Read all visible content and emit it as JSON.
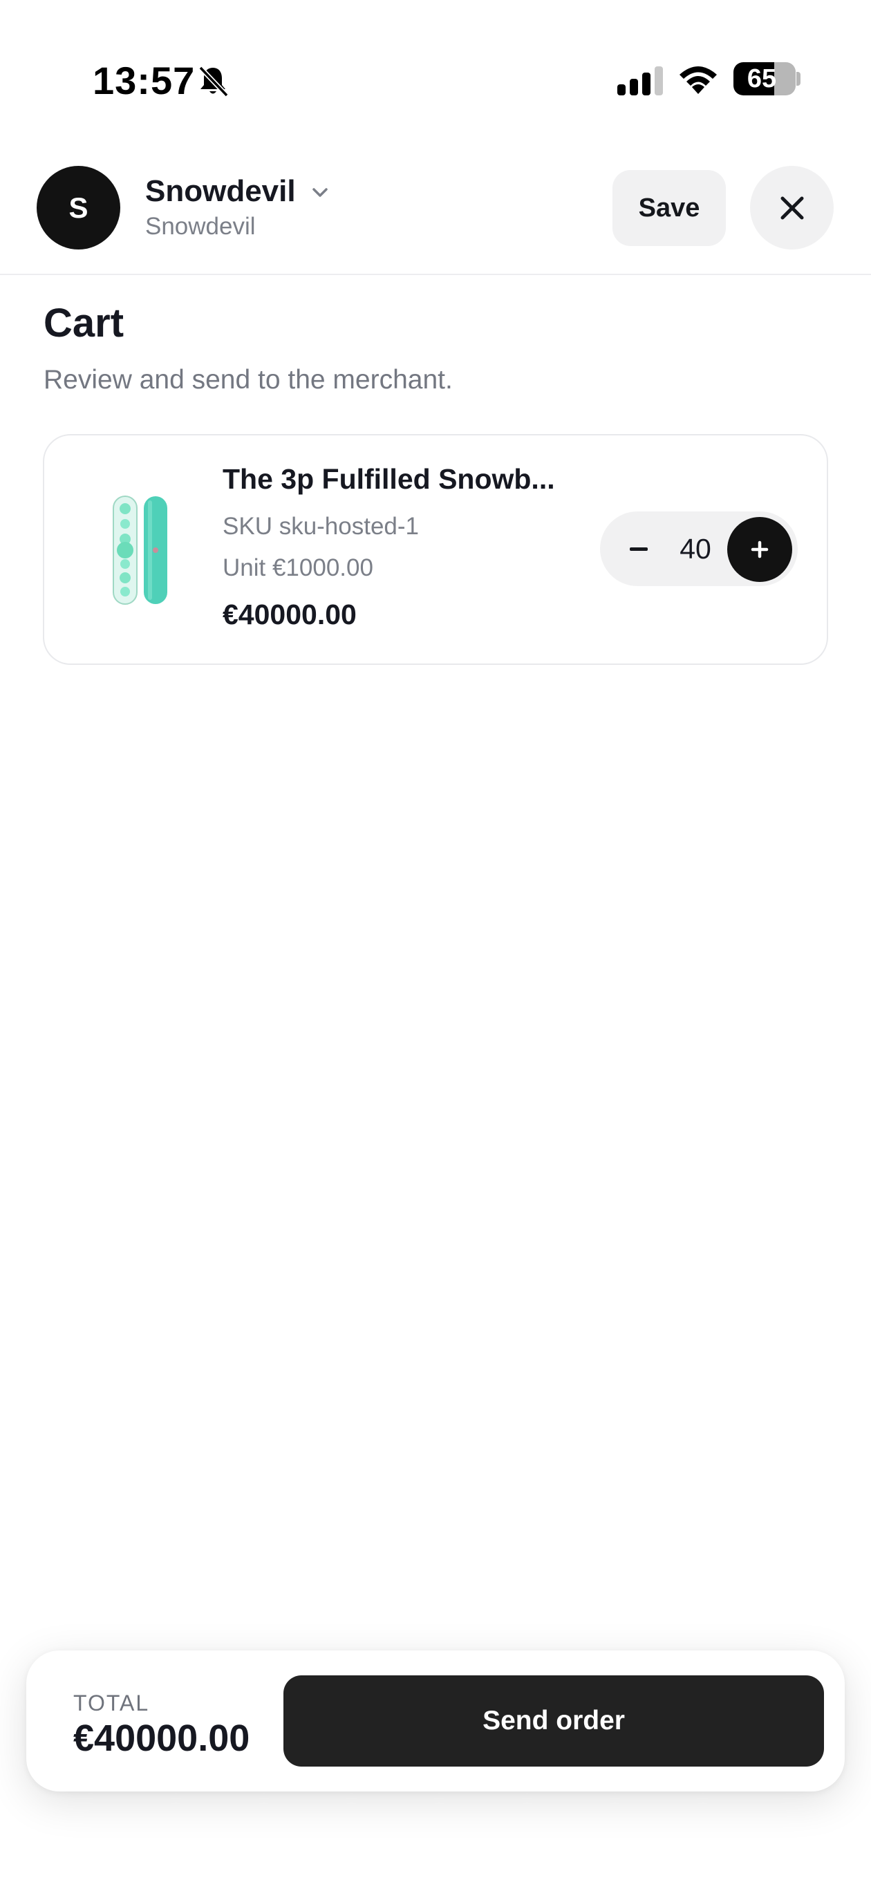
{
  "status_bar": {
    "time": "13:57",
    "battery_level": "65",
    "battery_fraction": 0.65,
    "icons": [
      "bell-slash-icon",
      "cellular-signal-icon",
      "wifi-icon",
      "battery-icon"
    ]
  },
  "header": {
    "avatar_initial": "S",
    "merchant_name": "Snowdevil",
    "merchant_subtitle": "Snowdevil",
    "save_label": "Save",
    "icons": [
      "chevron-down-icon",
      "close-icon"
    ]
  },
  "cart": {
    "title": "Cart",
    "subtitle": "Review and send to the merchant.",
    "items": [
      {
        "title": "The 3p Fulfilled Snowb...",
        "sku": "SKU sku-hosted-1",
        "unit_price": "Unit €1000.00",
        "line_total": "€40000.00",
        "quantity": "40",
        "image_icon": "snowboard-image"
      }
    ]
  },
  "footer": {
    "total_label": "TOTAL",
    "total_value": "€40000.00",
    "send_label": "Send order"
  },
  "colors": {
    "primary_dark": "#121212",
    "button_dark": "#222222",
    "muted_text": "#737781",
    "light_surface": "#f1f1f2",
    "product_teal": "#4fd0b8"
  }
}
